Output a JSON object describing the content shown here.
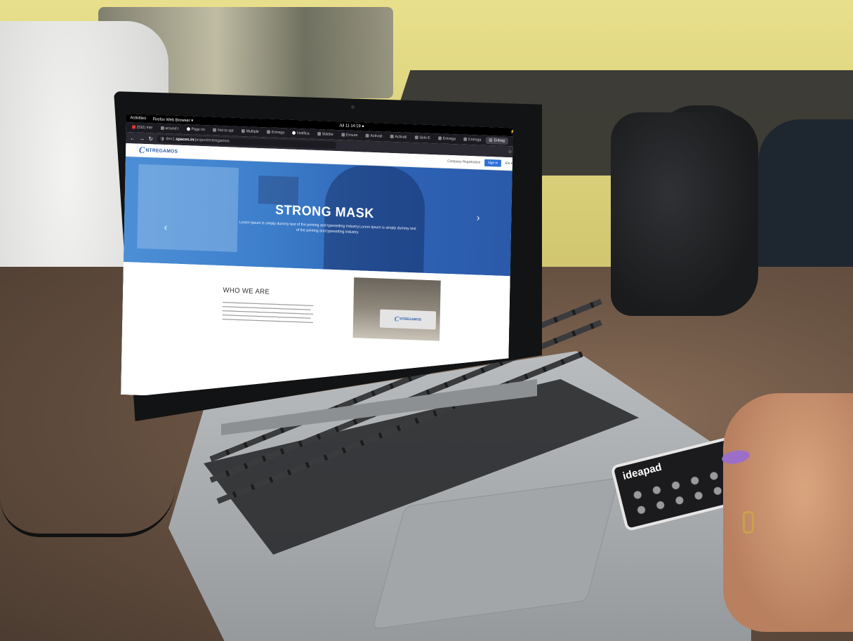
{
  "system_bar": {
    "activities": "Activities",
    "app": "Firefox Web Browser ▾",
    "clock": "Jul 11 14:19 ●"
  },
  "tabs": [
    {
      "label": "(532) Inte",
      "icon": "youtube-icon",
      "active": false
    },
    {
      "label": "around t",
      "icon": "page-icon",
      "active": false
    },
    {
      "label": "Page no",
      "icon": "github-icon",
      "active": false
    },
    {
      "label": "Not to opt",
      "icon": "page-icon",
      "active": false
    },
    {
      "label": "Multiple",
      "icon": "page-icon",
      "active": false
    },
    {
      "label": "Entrega",
      "icon": "page-icon",
      "active": false
    },
    {
      "label": "Notifica",
      "icon": "github-icon",
      "active": false
    },
    {
      "label": "Sidebe",
      "icon": "page-icon",
      "active": false
    },
    {
      "label": "Ensure",
      "icon": "page-icon",
      "active": false
    },
    {
      "label": "Activati",
      "icon": "page-icon",
      "active": false
    },
    {
      "label": "Activati",
      "icon": "page-icon",
      "active": false
    },
    {
      "label": "Selo E",
      "icon": "page-icon",
      "active": false
    },
    {
      "label": "Entrega",
      "icon": "page-icon",
      "active": false
    },
    {
      "label": "Entrega",
      "icon": "page-icon",
      "active": false
    },
    {
      "label": "Entreg",
      "icon": "page-icon",
      "active": true
    }
  ],
  "urlbar": {
    "prefix": "dev1.",
    "domain": "spaces.in",
    "path": "/project/entregamos"
  },
  "site": {
    "logo_letter": "C",
    "logo_text": "NTREGAMOS",
    "header_register": "Company Registration",
    "header_signin": "Sign in",
    "header_lang": "EN ▾",
    "hero_title": "STRONG MASK",
    "hero_text": "Lorem Ipsum is simply dummy text of the printing and typesetting industry.Lorem Ipsum is simply dummy text of the printing and typesetting industry.",
    "arrow_left": "‹",
    "arrow_right": "›",
    "about_title": "WHO WE ARE"
  },
  "keyboard": {
    "brand": "ideapad"
  }
}
